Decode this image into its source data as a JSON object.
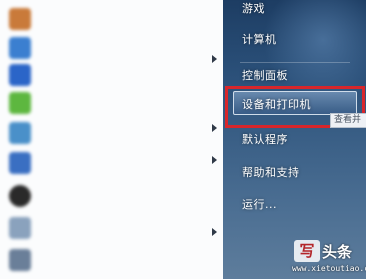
{
  "left_pane": {
    "items": [
      {
        "label": "",
        "icon": "app-icon",
        "color": "#c97a3a",
        "arrow": false
      },
      {
        "label": "",
        "icon": "app-icon",
        "color": "#3b7fd0",
        "arrow": false
      },
      {
        "label": "",
        "icon": "app-icon",
        "color": "#2b65c8",
        "arrow": false
      },
      {
        "label": "",
        "icon": "app-icon",
        "color": "#5db73f",
        "arrow": false
      },
      {
        "label": "",
        "icon": "app-icon",
        "color": "#4a90c9",
        "arrow": true
      },
      {
        "label": "",
        "icon": "app-icon",
        "color": "#3a6fc2",
        "arrow": true
      },
      {
        "label": "",
        "icon": "qq-icon",
        "color": "#2a2a2a",
        "arrow": false
      },
      {
        "label": "",
        "icon": "app-icon",
        "color": "#8aa2bd",
        "arrow": true
      },
      {
        "label": "",
        "icon": "app-icon",
        "color": "#6a7f99",
        "arrow": false
      }
    ]
  },
  "right_pane": {
    "items": [
      {
        "label": "游戏"
      },
      {
        "label": "计算机"
      },
      {
        "label": "控制面板"
      },
      {
        "label": "设备和打印机"
      },
      {
        "label": "默认程序"
      },
      {
        "label": "帮助和支持"
      },
      {
        "label": "运行..."
      }
    ],
    "tooltip": "查看并"
  },
  "watermark": {
    "logo_char": "写",
    "name": "头条",
    "url": "www.xietoutiao.com"
  },
  "colors": {
    "highlight": "#d8262b",
    "right_pane_top": "#1d3d63",
    "right_pane_bottom": "#5e7d9c"
  }
}
